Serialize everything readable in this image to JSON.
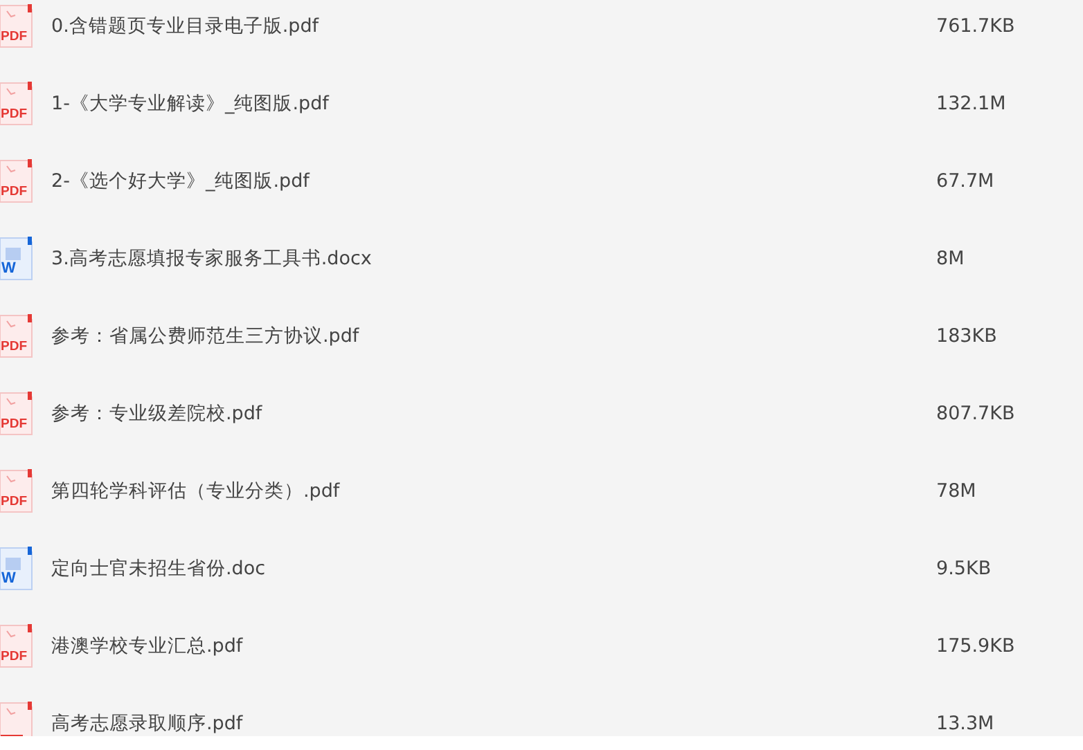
{
  "files": [
    {
      "kind": "pdf",
      "icon_text": "PDF",
      "name": "0.含错题页专业目录电子版.pdf",
      "size": "761.7KB"
    },
    {
      "kind": "pdf",
      "icon_text": "PDF",
      "name": "1-《大学专业解读》_纯图版.pdf",
      "size": "132.1M"
    },
    {
      "kind": "pdf",
      "icon_text": "PDF",
      "name": "2-《选个好大学》_纯图版.pdf",
      "size": "67.7M"
    },
    {
      "kind": "word",
      "icon_text": "W",
      "name": "3.高考志愿填报专家服务工具书.docx",
      "size": "8M"
    },
    {
      "kind": "pdf",
      "icon_text": "PDF",
      "name": "参考：省属公费师范生三方协议.pdf",
      "size": "183KB"
    },
    {
      "kind": "pdf",
      "icon_text": "PDF",
      "name": "参考：专业级差院校.pdf",
      "size": "807.7KB"
    },
    {
      "kind": "pdf",
      "icon_text": "PDF",
      "name": "第四轮学科评估（专业分类）.pdf",
      "size": "78M"
    },
    {
      "kind": "word",
      "icon_text": "W",
      "name": "定向士官未招生省份.doc",
      "size": "9.5KB"
    },
    {
      "kind": "pdf",
      "icon_text": "PDF",
      "name": "港澳学校专业汇总.pdf",
      "size": "175.9KB"
    },
    {
      "kind": "pdf",
      "name": "高考志愿录取顺序.pdf",
      "size": "13.3M"
    }
  ]
}
